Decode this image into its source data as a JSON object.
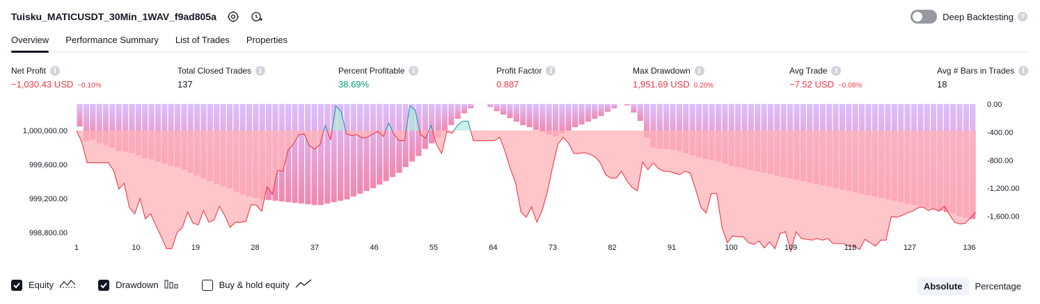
{
  "header": {
    "title": "Tuisku_MATICUSDT_30Min_1WAV_f9ad805a",
    "icons": [
      "gear-icon",
      "add-alert-icon"
    ]
  },
  "deep_backtesting": {
    "label": "Deep Backtesting",
    "enabled": false,
    "help": "?"
  },
  "tabs": [
    {
      "label": "Overview",
      "active": true
    },
    {
      "label": "Performance Summary",
      "active": false
    },
    {
      "label": "List of Trades",
      "active": false
    },
    {
      "label": "Properties",
      "active": false
    }
  ],
  "info_glyph": "i",
  "metrics": [
    {
      "label": "Net Profit",
      "value": "−1,030.43 USD",
      "pct": "−0.10%",
      "tone": "neg"
    },
    {
      "label": "Total Closed Trades",
      "value": "137",
      "pct": "",
      "tone": "neu"
    },
    {
      "label": "Percent Profitable",
      "value": "38.69%",
      "pct": "",
      "tone": "pos"
    },
    {
      "label": "Profit Factor",
      "value": "0.887",
      "pct": "",
      "tone": "neg"
    },
    {
      "label": "Max Drawdown",
      "value": "1,951.69 USD",
      "pct": "0.20%",
      "tone": "neg"
    },
    {
      "label": "Avg Trade",
      "value": "−7.52 USD",
      "pct": "−0.08%",
      "tone": "neg"
    },
    {
      "label": "Avg # Bars in Trades",
      "value": "18",
      "pct": "",
      "tone": "neu"
    }
  ],
  "chart_data": {
    "type": "area",
    "x_ticks": [
      "1",
      "10",
      "19",
      "28",
      "37",
      "46",
      "55",
      "64",
      "73",
      "82",
      "91",
      "100",
      "109",
      "118",
      "127",
      "136"
    ],
    "y_left_ticks": [
      "1,000,000.00",
      "999,600.00",
      "999,200.00",
      "998,800.00"
    ],
    "y_left_values": [
      1000000,
      999600,
      999200,
      998800
    ],
    "y_left_range": [
      998580,
      1000310
    ],
    "y_right_ticks": [
      "0.00",
      "-400.00",
      "-800.00",
      "-1,200.00",
      "-1,600.00"
    ],
    "y_right_values": [
      0,
      -400,
      -800,
      -1200,
      -1600
    ],
    "y_right_range": [
      -2100,
      0
    ],
    "baseline": 1000000,
    "series": [
      {
        "name": "Equity",
        "values": [
          1000000,
          999860,
          999620,
          999620,
          999620,
          999620,
          999620,
          999530,
          999310,
          999380,
          999090,
          999020,
          999200,
          998960,
          999020,
          998880,
          998750,
          998610,
          998610,
          998800,
          998860,
          999040,
          998910,
          998890,
          999060,
          998920,
          998950,
          999110,
          999000,
          998860,
          998920,
          998920,
          998930,
          999130,
          999120,
          999050,
          999340,
          999250,
          999530,
          999520,
          999770,
          999840,
          999950,
          999960,
          999820,
          999780,
          999830,
          1000060,
          999890,
          1000290,
          1000220,
          999960,
          999940,
          999950,
          999910,
          999920,
          999960,
          999990,
          999930,
          1000090,
          999950,
          999880,
          999880,
          1000290,
          1000240,
          999950,
          999910,
          1000060,
          999840,
          999730,
          999990,
          999970,
          1000060,
          1000110,
          1000110,
          999880,
          999880,
          999880,
          999880,
          999880,
          999920,
          999750,
          999550,
          999380,
          999040,
          998980,
          999100,
          998920,
          999060,
          999280,
          999580,
          999840,
          999920,
          999850,
          999730,
          999730,
          999740,
          999720,
          999690,
          999620,
          999480,
          999440,
          999440,
          999520,
          999410,
          999330,
          999290,
          999630,
          999540,
          999620,
          999550,
          999520,
          999520,
          999500,
          999480,
          999520,
          999500,
          999310,
          999100,
          999030,
          999260,
          999260,
          998860,
          998680,
          998760,
          998750,
          998750,
          998680,
          998660,
          998700,
          998620,
          998690,
          998610,
          998790,
          998810,
          998580,
          998810,
          998730,
          998720,
          998710,
          998730,
          998710,
          998730,
          998670,
          998670,
          998670,
          998640,
          998640,
          998600,
          998720,
          998680,
          998640,
          998710,
          998710,
          998990,
          998980,
          999000,
          999030,
          999050,
          999090,
          999100,
          999060,
          999080,
          999050,
          999110,
          999010,
          998920,
          998900,
          998910,
          998980,
          999040
        ]
      },
      {
        "name": "Drawdown",
        "values": [
          -320,
          -530,
          -510,
          -560,
          -580,
          -620,
          -670,
          -680,
          -700,
          -730,
          -770,
          -790,
          -820,
          -850,
          -880,
          -900,
          -940,
          -980,
          -1020,
          -1060,
          -1100,
          -1140,
          -1170,
          -1200,
          -1250,
          -1290,
          -1320,
          -1340,
          -1360,
          -1370,
          -1380,
          -1390,
          -1400,
          -1410,
          -1420,
          -1430,
          -1440,
          -1440,
          -1420,
          -1400,
          -1380,
          -1360,
          -1320,
          -1280,
          -1240,
          -1200,
          -1150,
          -1100,
          -1040,
          -980,
          -900,
          -820,
          -740,
          -640,
          -560,
          -480,
          -380,
          -300,
          -210,
          -130,
          -60,
          0,
          0,
          -40,
          -100,
          -150,
          -200,
          -250,
          -300,
          -330,
          -370,
          -400,
          -430,
          -460,
          -420,
          -380,
          -330,
          -290,
          -250,
          -210,
          -170,
          -110,
          -60,
          0,
          -20,
          -120,
          -240,
          -480,
          -620,
          -640,
          -640,
          -650,
          -670,
          -700,
          -730,
          -760,
          -780,
          -800,
          -820,
          -850,
          -880,
          -900,
          -920,
          -940,
          -960,
          -980,
          -1000,
          -1020,
          -1040,
          -1060,
          -1080,
          -1100,
          -1120,
          -1140,
          -1160,
          -1180,
          -1200,
          -1220,
          -1240,
          -1260,
          -1280,
          -1300,
          -1320,
          -1340,
          -1360,
          -1380,
          -1400,
          -1420,
          -1440,
          -1460,
          -1480,
          -1500,
          -1520,
          -1540,
          -1560,
          -1600,
          -1620,
          -1640
        ]
      }
    ]
  },
  "legend": [
    {
      "label": "Equity",
      "checked": true,
      "icon": "equity-line-icon"
    },
    {
      "label": "Drawdown",
      "checked": true,
      "icon": "drawdown-bars-icon"
    },
    {
      "label": "Buy & hold equity",
      "checked": false,
      "icon": "buy-hold-line-icon"
    }
  ],
  "mode_buttons": [
    {
      "label": "Absolute",
      "active": true
    },
    {
      "label": "Percentage",
      "active": false
    }
  ],
  "colors": {
    "accent": "#131722",
    "negative": "#f23645",
    "positive": "#089981",
    "drawdown_top": "#d7b8ff",
    "drawdown_bottom": "#f07aa6",
    "equity_line": "#f23645",
    "equity_fill_below": "#ffb3b8",
    "equity_fill_above": "#b2ebd8",
    "equity_line_above": "#2d8bba"
  }
}
